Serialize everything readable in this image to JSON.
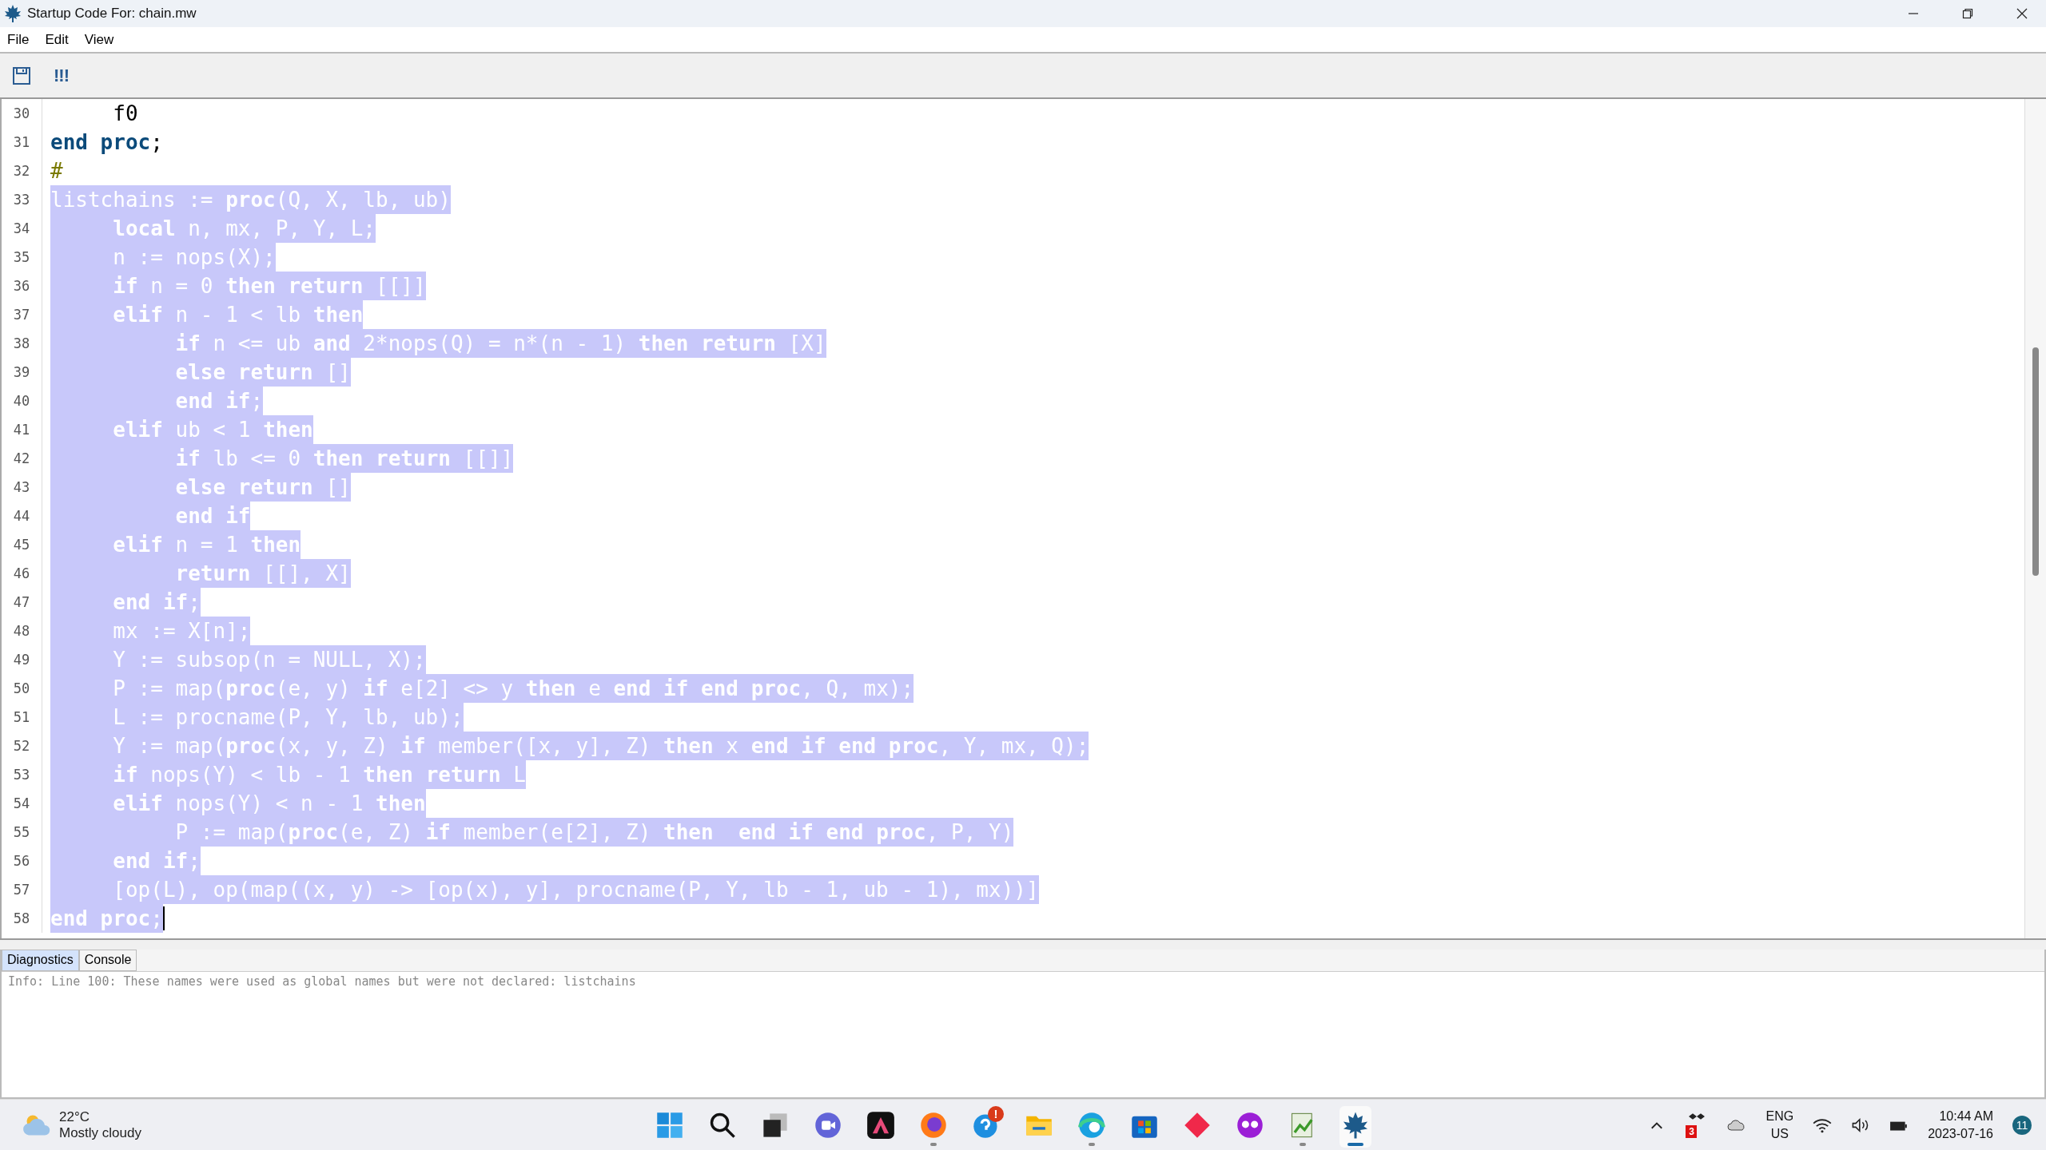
{
  "window": {
    "title": "Startup Code For: chain.mw"
  },
  "menu": [
    "File",
    "Edit",
    "View"
  ],
  "toolbar": {
    "run_label": "!!!"
  },
  "editor": {
    "lines": [
      {
        "number": "30",
        "kind": "code",
        "text": "     f0",
        "selected": false,
        "cursor": false
      },
      {
        "number": "31",
        "kind": "code",
        "text": "**end proc**;",
        "selected": false,
        "cursor": false
      },
      {
        "number": "32",
        "kind": "comment",
        "text": "#",
        "selected": false,
        "cursor": false
      },
      {
        "number": "33",
        "kind": "code",
        "text": "listchains := **proc**(Q, X, lb, ub)",
        "selected": true,
        "cursor": false
      },
      {
        "number": "34",
        "kind": "code",
        "text": "     **local** n, mx, P, Y, L;",
        "selected": true,
        "cursor": false
      },
      {
        "number": "35",
        "kind": "code",
        "text": "     n := nops(X);",
        "selected": true,
        "cursor": false
      },
      {
        "number": "36",
        "kind": "code",
        "text": "     **if** n = 0 **then return** [[]]",
        "selected": true,
        "cursor": false
      },
      {
        "number": "37",
        "kind": "code",
        "text": "     **elif** n - 1 < lb **then**",
        "selected": true,
        "cursor": false
      },
      {
        "number": "38",
        "kind": "code",
        "text": "          **if** n <= ub **and** 2*nops(Q) = n*(n - 1) **then return** [X]",
        "selected": true,
        "cursor": false
      },
      {
        "number": "39",
        "kind": "code",
        "text": "          **else return** []",
        "selected": true,
        "cursor": false
      },
      {
        "number": "40",
        "kind": "code",
        "text": "          **end if**;",
        "selected": true,
        "cursor": false
      },
      {
        "number": "41",
        "kind": "code",
        "text": "     **elif** ub < 1 **then**",
        "selected": true,
        "cursor": false
      },
      {
        "number": "42",
        "kind": "code",
        "text": "          **if** lb <= 0 **then return** [[]]",
        "selected": true,
        "cursor": false
      },
      {
        "number": "43",
        "kind": "code",
        "text": "          **else return** []",
        "selected": true,
        "cursor": false
      },
      {
        "number": "44",
        "kind": "code",
        "text": "          **end if**",
        "selected": true,
        "cursor": false
      },
      {
        "number": "45",
        "kind": "code",
        "text": "     **elif** n = 1 **then**",
        "selected": true,
        "cursor": false
      },
      {
        "number": "46",
        "kind": "code",
        "text": "          **return** [[], X]",
        "selected": true,
        "cursor": false
      },
      {
        "number": "47",
        "kind": "code",
        "text": "     **end if**;",
        "selected": true,
        "cursor": false
      },
      {
        "number": "48",
        "kind": "code",
        "text": "     mx := X[n];",
        "selected": true,
        "cursor": false
      },
      {
        "number": "49",
        "kind": "code",
        "text": "     Y := subsop(n = NULL, X);",
        "selected": true,
        "cursor": false
      },
      {
        "number": "50",
        "kind": "code",
        "text": "     P := map(**proc**(e, y) **if** e[2] <> y **then** e **end if end proc**, Q, mx);",
        "selected": true,
        "cursor": false
      },
      {
        "number": "51",
        "kind": "code",
        "text": "     L := procname(P, Y, lb, ub);",
        "selected": true,
        "cursor": false
      },
      {
        "number": "52",
        "kind": "code",
        "text": "     Y := map(**proc**(x, y, Z) **if** member([x, y], Z) **then** x **end if end proc**, Y, mx, Q);",
        "selected": true,
        "cursor": false
      },
      {
        "number": "53",
        "kind": "code",
        "text": "     **if** nops(Y) < lb - 1 **then return** L",
        "selected": true,
        "cursor": false
      },
      {
        "number": "54",
        "kind": "code",
        "text": "     **elif** nops(Y) < n - 1 **then**",
        "selected": true,
        "cursor": false
      },
      {
        "number": "55",
        "kind": "code",
        "text": "          P := map(**proc**(e, Z) **if** member(e[2], Z) **then  end if end proc**, P, Y)",
        "selected": true,
        "cursor": false
      },
      {
        "number": "56",
        "kind": "code",
        "text": "     **end if**;",
        "selected": true,
        "cursor": false
      },
      {
        "number": "57",
        "kind": "code",
        "text": "     [op(L), op(map((x, y) -> [op(x), y], procname(P, Y, lb - 1, ub - 1), mx))]",
        "selected": true,
        "cursor": false
      },
      {
        "number": "58",
        "kind": "code",
        "text": "**end proc**;",
        "selected": true,
        "cursor": true
      }
    ]
  },
  "diagnostics": {
    "tabs": [
      {
        "label": "Diagnostics",
        "selected": true
      },
      {
        "label": "Console",
        "selected": false
      }
    ],
    "message": "Info: Line 100: These names were used as global names but were not declared: listchains"
  },
  "taskbar": {
    "weather": {
      "temperature": "22°C",
      "condition": "Mostly cloudy"
    },
    "apps": [
      {
        "kind": "start",
        "running": false,
        "selected": false
      },
      {
        "kind": "search",
        "running": false,
        "selected": false
      },
      {
        "kind": "task-view",
        "running": false,
        "selected": false
      },
      {
        "kind": "chat",
        "running": false,
        "selected": false
      },
      {
        "kind": "triangle",
        "running": false,
        "selected": false
      },
      {
        "kind": "browser-fox",
        "running": true,
        "selected": false
      },
      {
        "kind": "help",
        "running": false,
        "selected": false,
        "badge": "!"
      },
      {
        "kind": "folder",
        "running": false,
        "selected": false
      },
      {
        "kind": "browser-wave",
        "running": true,
        "selected": false
      },
      {
        "kind": "store",
        "running": false,
        "selected": false
      },
      {
        "kind": "diamond",
        "running": false,
        "selected": false
      },
      {
        "kind": "mask",
        "running": false,
        "selected": false
      },
      {
        "kind": "notepad",
        "running": true,
        "selected": false
      },
      {
        "kind": "maple",
        "running": true,
        "selected": true
      }
    ],
    "tray": {
      "dropbox_badge": "3",
      "language": "ENG",
      "region": "US",
      "time": "10:44 AM",
      "date": "2023-07-16",
      "notifications": "11"
    }
  }
}
